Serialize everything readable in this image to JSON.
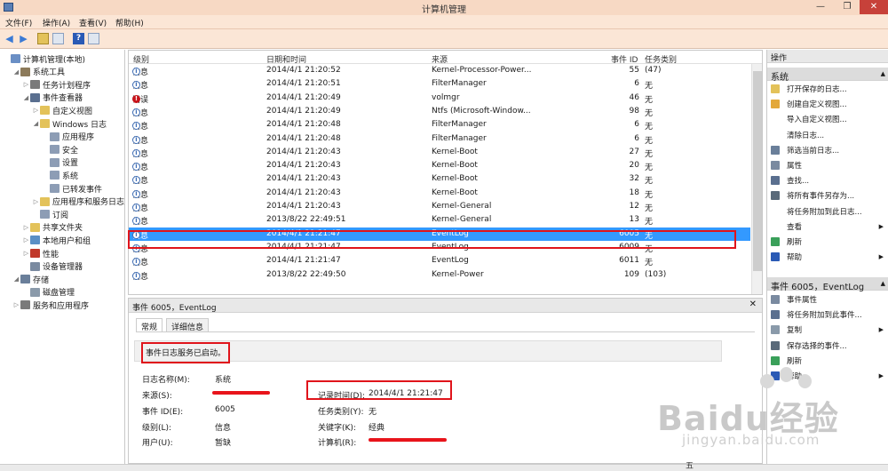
{
  "window": {
    "title": "计算机管理",
    "minimize": "—",
    "restore": "❐",
    "close": "✕"
  },
  "menu": [
    "文件(F)",
    "操作(A)",
    "查看(V)",
    "帮助(H)"
  ],
  "tree": [
    {
      "label": "计算机管理(本地)",
      "indent": 0,
      "expander": "",
      "icon": "#6a8fc5"
    },
    {
      "label": "系统工具",
      "indent": 1,
      "expander": "◢",
      "icon": "#8c7a5a"
    },
    {
      "label": "任务计划程序",
      "indent": 2,
      "expander": "▷",
      "icon": "#7a7a7a"
    },
    {
      "label": "事件查看器",
      "indent": 2,
      "expander": "◢",
      "icon": "#5a6f8f"
    },
    {
      "label": "自定义视图",
      "indent": 3,
      "expander": "▷",
      "icon": "#e3c25a"
    },
    {
      "label": "Windows 日志",
      "indent": 3,
      "expander": "◢",
      "icon": "#e3c25a"
    },
    {
      "label": "应用程序",
      "indent": 4,
      "expander": "",
      "icon": "#8d9db5"
    },
    {
      "label": "安全",
      "indent": 4,
      "expander": "",
      "icon": "#8d9db5"
    },
    {
      "label": "设置",
      "indent": 4,
      "expander": "",
      "icon": "#8d9db5"
    },
    {
      "label": "系统",
      "indent": 4,
      "expander": "",
      "icon": "#8d9db5"
    },
    {
      "label": "已转发事件",
      "indent": 4,
      "expander": "",
      "icon": "#8d9db5"
    },
    {
      "label": "应用程序和服务日志",
      "indent": 3,
      "expander": "▷",
      "icon": "#e3c25a"
    },
    {
      "label": "订阅",
      "indent": 3,
      "expander": "",
      "icon": "#8d9db5"
    },
    {
      "label": "共享文件夹",
      "indent": 2,
      "expander": "▷",
      "icon": "#e3c25a"
    },
    {
      "label": "本地用户和组",
      "indent": 2,
      "expander": "▷",
      "icon": "#5a8fc5"
    },
    {
      "label": "性能",
      "indent": 2,
      "expander": "▷",
      "icon": "#c0392b"
    },
    {
      "label": "设备管理器",
      "indent": 2,
      "expander": "",
      "icon": "#7a8aa0"
    },
    {
      "label": "存储",
      "indent": 1,
      "expander": "◢",
      "icon": "#6a7f9a"
    },
    {
      "label": "磁盘管理",
      "indent": 2,
      "expander": "",
      "icon": "#8a9aaa"
    },
    {
      "label": "服务和应用程序",
      "indent": 1,
      "expander": "▷",
      "icon": "#7a7a7a"
    }
  ],
  "grid": {
    "headers": {
      "level": "级别",
      "datetime": "日期和时间",
      "source": "来源",
      "eventid": "事件 ID",
      "category": "任务类别"
    },
    "rows": [
      {
        "level": "信息",
        "type": "info",
        "datetime": "2014/4/1 21:20:52",
        "source": "Kernel-Processor-Power...",
        "eventid": "55",
        "category": "(47)"
      },
      {
        "level": "信息",
        "type": "info",
        "datetime": "2014/4/1 21:20:51",
        "source": "FilterManager",
        "eventid": "6",
        "category": "无"
      },
      {
        "level": "错误",
        "type": "error",
        "datetime": "2014/4/1 21:20:49",
        "source": "volmgr",
        "eventid": "46",
        "category": "无"
      },
      {
        "level": "信息",
        "type": "info",
        "datetime": "2014/4/1 21:20:49",
        "source": "Ntfs (Microsoft-Window...",
        "eventid": "98",
        "category": "无"
      },
      {
        "level": "信息",
        "type": "info",
        "datetime": "2014/4/1 21:20:48",
        "source": "FilterManager",
        "eventid": "6",
        "category": "无"
      },
      {
        "level": "信息",
        "type": "info",
        "datetime": "2014/4/1 21:20:48",
        "source": "FilterManager",
        "eventid": "6",
        "category": "无"
      },
      {
        "level": "信息",
        "type": "info",
        "datetime": "2014/4/1 21:20:43",
        "source": "Kernel-Boot",
        "eventid": "27",
        "category": "无"
      },
      {
        "level": "信息",
        "type": "info",
        "datetime": "2014/4/1 21:20:43",
        "source": "Kernel-Boot",
        "eventid": "20",
        "category": "无"
      },
      {
        "level": "信息",
        "type": "info",
        "datetime": "2014/4/1 21:20:43",
        "source": "Kernel-Boot",
        "eventid": "32",
        "category": "无"
      },
      {
        "level": "信息",
        "type": "info",
        "datetime": "2014/4/1 21:20:43",
        "source": "Kernel-Boot",
        "eventid": "18",
        "category": "无"
      },
      {
        "level": "信息",
        "type": "info",
        "datetime": "2014/4/1 21:20:43",
        "source": "Kernel-General",
        "eventid": "12",
        "category": "无"
      },
      {
        "level": "信息",
        "type": "info",
        "datetime": "2013/8/22 22:49:51",
        "source": "Kernel-General",
        "eventid": "13",
        "category": "无"
      },
      {
        "level": "信息",
        "type": "info",
        "datetime": "2014/4/1 21:21:47",
        "source": "EventLog",
        "eventid": "6005",
        "category": "无",
        "selected": true
      },
      {
        "level": "信息",
        "type": "info",
        "datetime": "2014/4/1 21:21:47",
        "source": "EventLog",
        "eventid": "6009",
        "category": "无"
      },
      {
        "level": "信息",
        "type": "info",
        "datetime": "2014/4/1 21:21:47",
        "source": "EventLog",
        "eventid": "6011",
        "category": "无"
      },
      {
        "level": "信息",
        "type": "info",
        "datetime": "2013/8/22 22:49:50",
        "source": "Kernel-Power",
        "eventid": "109",
        "category": "(103)"
      }
    ]
  },
  "detail": {
    "title": "事件 6005，EventLog",
    "tabs": [
      "常规",
      "详细信息"
    ],
    "message": "事件日志服务已启动。",
    "fields": {
      "logname_label": "日志名称(M):",
      "logname": "系统",
      "source_label": "来源(S):",
      "recorded_label": "记录时间(D):",
      "recorded": "2014/4/1 21:21:47",
      "eventid_label": "事件 ID(E):",
      "eventid": "6005",
      "taskcat_label": "任务类别(Y):",
      "taskcat": "无",
      "level_label": "级别(L):",
      "level": "信息",
      "keywords_label": "关键字(K):",
      "keywords": "经典",
      "user_label": "用户(U):",
      "user": "暂缺",
      "computer_label": "计算机(R):"
    }
  },
  "actions": {
    "header": "操作",
    "section1": "系统",
    "items1": [
      {
        "label": "打开保存的日志...",
        "icon": "#e3c25a"
      },
      {
        "label": "创建自定义视图...",
        "icon": "#e3a83a"
      },
      {
        "label": "导入自定义视图...",
        "icon": ""
      },
      {
        "label": "清除日志...",
        "icon": ""
      },
      {
        "label": "筛选当前日志...",
        "icon": "#6a7f9a"
      },
      {
        "label": "属性",
        "icon": "#7a8aa0"
      },
      {
        "label": "查找...",
        "icon": "#5a6f8f"
      },
      {
        "label": "将所有事件另存为...",
        "icon": "#5a6a7a"
      },
      {
        "label": "将任务附加到此日志...",
        "icon": ""
      },
      {
        "label": "查看",
        "icon": "",
        "arrow": true
      },
      {
        "label": "刷新",
        "icon": "#3aa05a"
      },
      {
        "label": "帮助",
        "icon": "#2a5ab5",
        "arrow": true
      }
    ],
    "section2": "事件 6005，EventLog",
    "items2": [
      {
        "label": "事件属性",
        "icon": "#7a8aa0"
      },
      {
        "label": "将任务附加到此事件...",
        "icon": "#5a6f8f"
      },
      {
        "label": "复制",
        "icon": "#8a9aaa",
        "arrow": true
      },
      {
        "label": "保存选择的事件...",
        "icon": "#5a6a7a"
      },
      {
        "label": "刷新",
        "icon": "#3aa05a"
      },
      {
        "label": "帮助",
        "icon": "#2a5ab5",
        "arrow": true
      }
    ]
  },
  "watermark": {
    "brand": "Baidu经验",
    "url": "jingyan.baidu.com"
  },
  "taskbar_tray": "五"
}
